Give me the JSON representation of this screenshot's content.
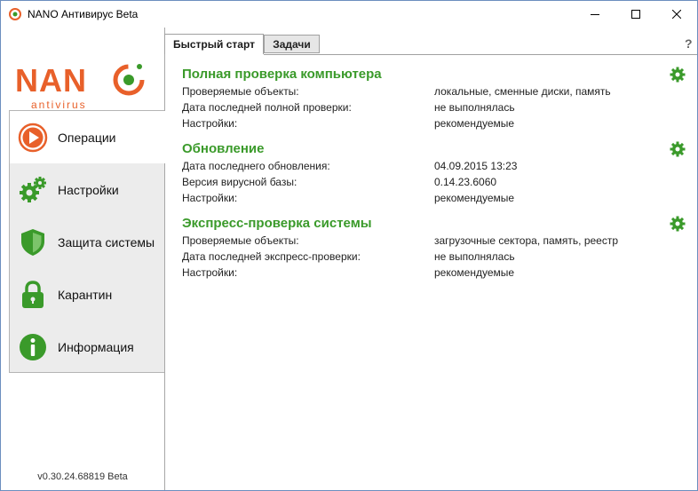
{
  "window": {
    "title": "NANO Антивирус Beta"
  },
  "sidebar": {
    "logo": {
      "word": "NANO",
      "sub": "antivirus"
    },
    "items": [
      {
        "label": "Операции",
        "icon": "play-circle-icon"
      },
      {
        "label": "Настройки",
        "icon": "gears-icon"
      },
      {
        "label": "Защита системы",
        "icon": "shield-icon"
      },
      {
        "label": "Карантин",
        "icon": "lock-icon"
      },
      {
        "label": "Информация",
        "icon": "info-icon"
      }
    ],
    "active_index": 0,
    "version": "v0.30.24.68819 Beta"
  },
  "help": "?",
  "tabs": [
    {
      "label": "Быстрый старт"
    },
    {
      "label": "Задачи"
    }
  ],
  "sections": [
    {
      "title": "Полная проверка компьютера",
      "rows": [
        {
          "k": "Проверяемые объекты:",
          "v": "локальные, сменные диски, память"
        },
        {
          "k": "Дата последней полной проверки:",
          "v": "не выполнялась"
        },
        {
          "k": "Настройки:",
          "v": "рекомендуемые"
        }
      ]
    },
    {
      "title": "Обновление",
      "rows": [
        {
          "k": "Дата последнего обновления:",
          "v": "04.09.2015 13:23"
        },
        {
          "k": "Версия вирусной базы:",
          "v": "0.14.23.6060"
        },
        {
          "k": "Настройки:",
          "v": "рекомендуемые"
        }
      ]
    },
    {
      "title": "Экспресс-проверка системы",
      "rows": [
        {
          "k": "Проверяемые объекты:",
          "v": "загрузочные сектора, память, реестр"
        },
        {
          "k": "Дата последней экспресс-проверки:",
          "v": "не выполнялась"
        },
        {
          "k": "Настройки:",
          "v": "рекомендуемые"
        }
      ]
    }
  ],
  "colors": {
    "green": "#3a9a2a",
    "orange": "#e8602a"
  }
}
